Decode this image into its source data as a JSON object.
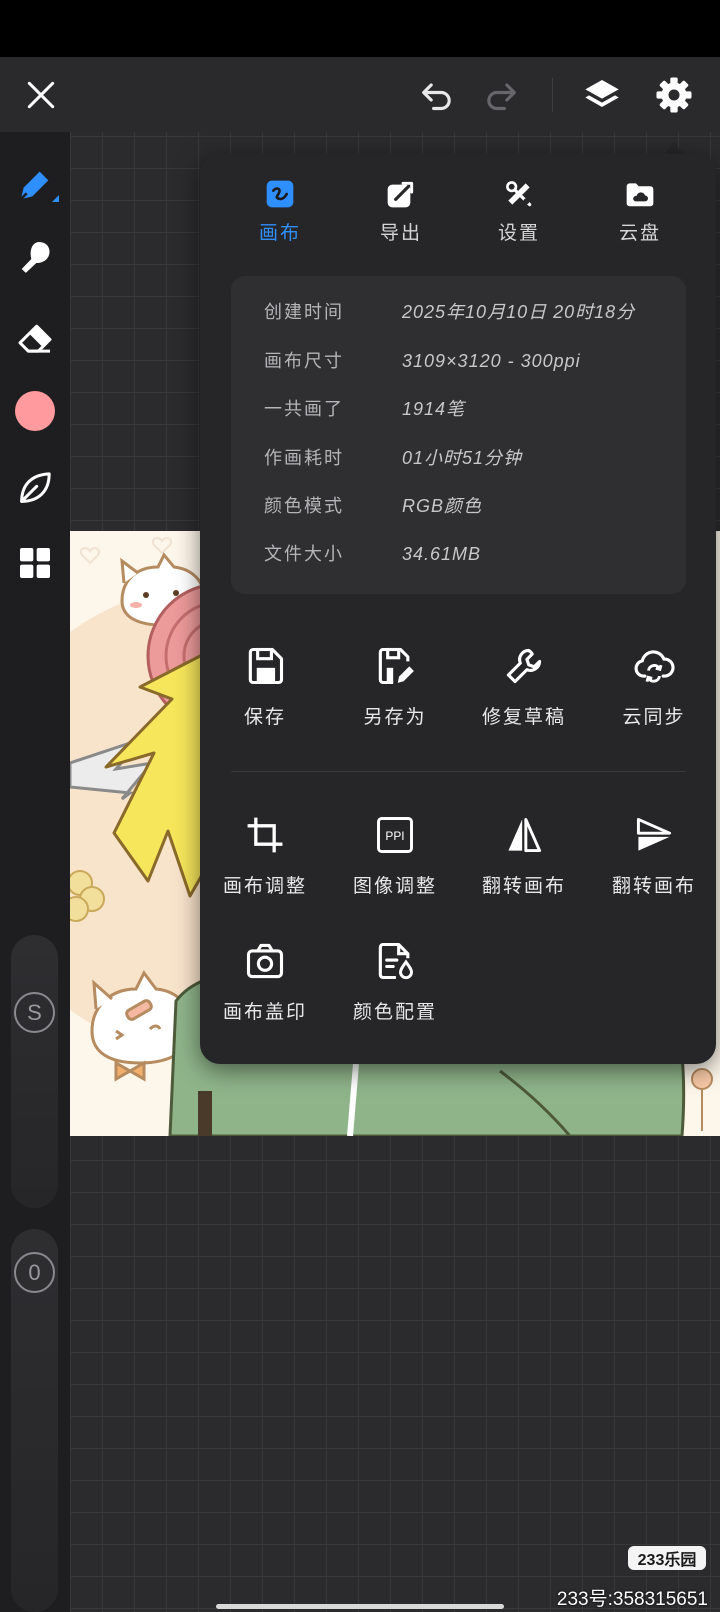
{
  "app": {
    "accent_color": "#2f8fff",
    "canvas_background": "#2b2b2d",
    "panel_background": "#262628"
  },
  "toolbar": {
    "close_icon": "close-icon",
    "undo_icon": "undo-icon",
    "redo_icon": "redo-icon",
    "layers_icon": "layers-icon",
    "settings_icon": "gear-icon"
  },
  "sidebar": {
    "tools": [
      {
        "name": "pen",
        "icon": "pen-icon",
        "active": true
      },
      {
        "name": "smudge",
        "icon": "smudge-icon"
      },
      {
        "name": "eraser",
        "icon": "eraser-icon"
      },
      {
        "name": "color",
        "color": "#ff9a9e"
      },
      {
        "name": "leaf",
        "icon": "leaf-icon"
      },
      {
        "name": "gallery",
        "icon": "grid-icon"
      }
    ],
    "size_slider": {
      "label": "S"
    },
    "opacity_slider": {
      "label": "0"
    }
  },
  "panel": {
    "tabs": [
      {
        "label": "画布",
        "icon": "canvas-icon",
        "active": true
      },
      {
        "label": "导出",
        "icon": "export-icon"
      },
      {
        "label": "设置",
        "icon": "tools-icon"
      },
      {
        "label": "云盘",
        "icon": "cloud-folder-icon"
      }
    ],
    "info": [
      {
        "label": "创建时间",
        "value": "2025年10月10日 20时18分"
      },
      {
        "label": "画布尺寸",
        "value": "3109×3120 - 300ppi"
      },
      {
        "label": "一共画了",
        "value": "1914笔"
      },
      {
        "label": "作画耗时",
        "value": "01小时51分钟"
      },
      {
        "label": "颜色模式",
        "value": "RGB颜色"
      },
      {
        "label": "文件大小",
        "value": "34.61MB"
      }
    ],
    "actions": [
      {
        "label": "保存",
        "icon": "save-icon"
      },
      {
        "label": "另存为",
        "icon": "save-as-icon"
      },
      {
        "label": "修复草稿",
        "icon": "wrench-icon"
      },
      {
        "label": "云同步",
        "icon": "cloud-sync-icon"
      },
      {
        "label": "画布调整",
        "icon": "crop-icon"
      },
      {
        "label": "图像调整",
        "icon": "ppi-icon",
        "icon_text": "PPI"
      },
      {
        "label": "翻转画布",
        "icon": "flip-horizontal-icon"
      },
      {
        "label": "翻转画布",
        "icon": "flip-vertical-icon"
      },
      {
        "label": "画布盖印",
        "icon": "camera-icon"
      },
      {
        "label": "颜色配置",
        "icon": "color-profile-icon"
      }
    ]
  },
  "watermark": {
    "brand": "233乐园",
    "id_text": "233号:358315651"
  }
}
